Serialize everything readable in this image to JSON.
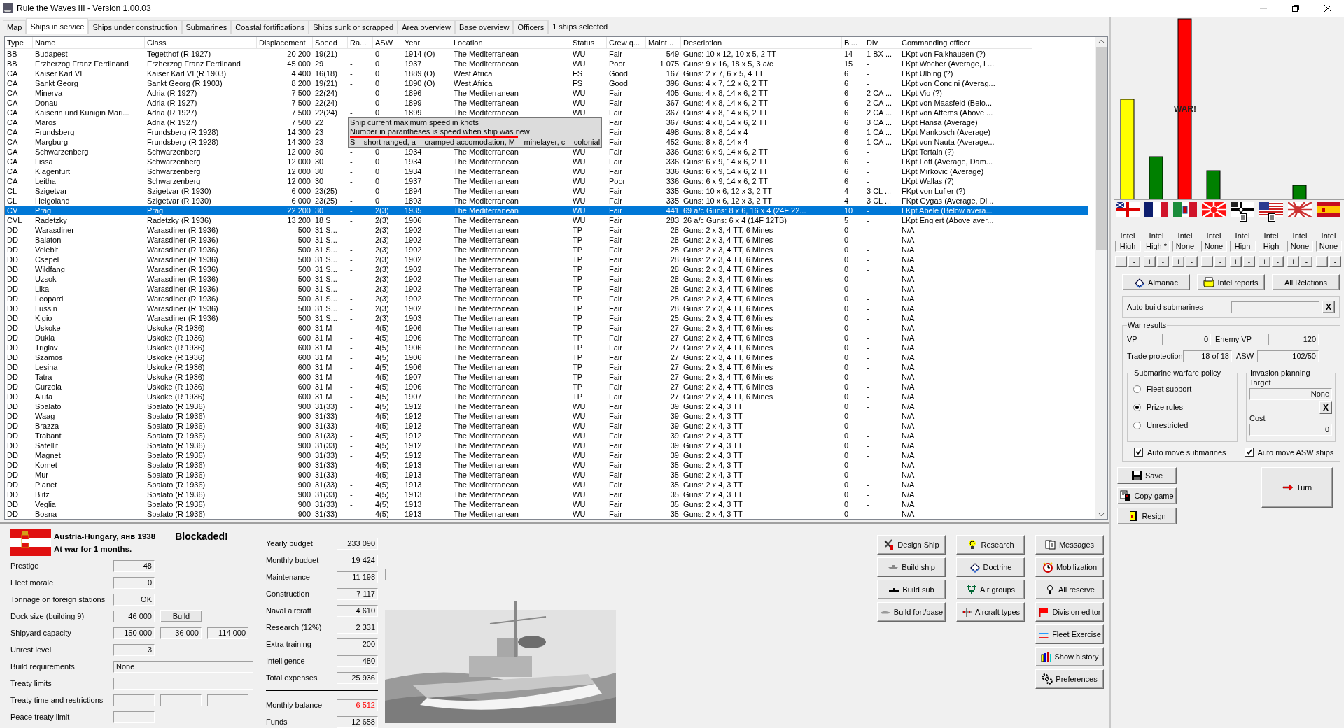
{
  "window": {
    "title": "Rule the Waves III - Version 1.00.03"
  },
  "tabs": [
    {
      "label": "Map",
      "selected": false
    },
    {
      "label": "Ships in service",
      "selected": true
    },
    {
      "label": "Ships under construction",
      "selected": false
    },
    {
      "label": "Submarines",
      "selected": false
    },
    {
      "label": "Coastal fortifications",
      "selected": false
    },
    {
      "label": "Ships sunk or scrapped",
      "selected": false
    },
    {
      "label": "Area overview",
      "selected": false
    },
    {
      "label": "Base overview",
      "selected": false
    },
    {
      "label": "Officers",
      "selected": false
    }
  ],
  "selection_count": "1 ships selected",
  "table": {
    "columns": [
      "Type",
      "Name",
      "Class",
      "Displacement",
      "Speed",
      "Ra...",
      "ASW",
      "Year",
      "Location",
      "Status",
      "Crew q...",
      "Maint...",
      "Description",
      "Bl...",
      "Div",
      "Commanding officer"
    ],
    "rows": [
      {
        "cells": [
          "BB",
          "Budapest",
          "Tegetthof (R 1927)",
          "20 200",
          "19(21)",
          "-",
          "0",
          "1914 (O)",
          "The Mediterranean",
          "WU",
          "Fair",
          "549",
          "Guns: 10 x 12, 10 x 5, 2 TT",
          "14",
          "1 BX ...",
          "LKpt von Falkhausen (?)"
        ],
        "selected": false
      },
      {
        "cells": [
          "BB",
          "Erzherzog Franz Ferdinand",
          "Erzherzog Franz Ferdinand",
          "45 000",
          "29",
          "-",
          "0",
          "1937",
          "The Mediterranean",
          "WU",
          "Poor",
          "1 075",
          "Guns: 9 x 16, 18 x 5, 3 a/c",
          "15",
          "-",
          "LKpt Wocher (Average, L..."
        ],
        "selected": false
      },
      {
        "cells": [
          "CA",
          "Kaiser Karl VI",
          "Kaiser Karl VI (R 1903)",
          "4 400",
          "16(18)",
          "-",
          "0",
          "1889 (O)",
          "West Africa",
          "FS",
          "Good",
          "167",
          "Guns: 2 x 7, 6 x 5, 4 TT",
          "6",
          "-",
          "LKpt Ulbing (?)"
        ],
        "selected": false
      },
      {
        "cells": [
          "CA",
          "Sankt Georg",
          "Sankt Georg (R 1903)",
          "8 200",
          "19(21)",
          "-",
          "0",
          "1890 (O)",
          "West Africa",
          "FS",
          "Good",
          "396",
          "Guns: 4 x 7, 12 x 6, 2 TT",
          "6",
          "-",
          "LKpt von Concini (Averag..."
        ],
        "selected": false
      },
      {
        "cells": [
          "CA",
          "Minerva",
          "Adria (R 1927)",
          "7 500",
          "22(24)",
          "-",
          "0",
          "1896",
          "The Mediterranean",
          "WU",
          "Fair",
          "405",
          "Guns: 4 x 8, 14 x 6, 2 TT",
          "6",
          "2 CA ...",
          "LKpt Vio (?)"
        ],
        "selected": false
      },
      {
        "cells": [
          "CA",
          "Donau",
          "Adria (R 1927)",
          "7 500",
          "22(24)",
          "-",
          "0",
          "1899",
          "The Mediterranean",
          "WU",
          "Fair",
          "367",
          "Guns: 4 x 8, 14 x 6, 2 TT",
          "6",
          "2 CA ...",
          "LKpt von Maasfeld (Belo..."
        ],
        "selected": false
      },
      {
        "cells": [
          "CA",
          "Kaiserin und Kunigin Mari...",
          "Adria (R 1927)",
          "7 500",
          "22(24)",
          "-",
          "0",
          "1899",
          "The Mediterranean",
          "WU",
          "Fair",
          "367",
          "Guns: 4 x 8, 14 x 6, 2 TT",
          "6",
          "2 CA ...",
          "LKpt von Attems (Above ..."
        ],
        "selected": false
      },
      {
        "cells": [
          "CA",
          "Maros",
          "Adria (R 1927)",
          "7 500",
          "22",
          null,
          null,
          null,
          null,
          null,
          "Fair",
          "367",
          "Guns: 4 x 8, 14 x 6, 2 TT",
          "6",
          "3 CA ...",
          "LKpt Hansa (Average)"
        ],
        "selected": false
      },
      {
        "cells": [
          "CA",
          "Frundsberg",
          "Frundsberg (R 1928)",
          "14 300",
          "23",
          null,
          null,
          null,
          null,
          null,
          "Fair",
          "498",
          "Guns: 8 x 8, 14 x 4",
          "6",
          "1 CA ...",
          "LKpt Mankosch (Average)"
        ],
        "selected": false
      },
      {
        "cells": [
          "CA",
          "Margburg",
          "Frundsberg (R 1928)",
          "14 300",
          "23",
          null,
          null,
          null,
          null,
          null,
          "Fair",
          "452",
          "Guns: 8 x 8, 14 x 4",
          "6",
          "1 CA ...",
          "LKpt von Nauta (Average..."
        ],
        "selected": false
      },
      {
        "cells": [
          "CA",
          "Schwarzenberg",
          "Schwarzenberg",
          "12 000",
          "30",
          "-",
          "0",
          "1934",
          "The Mediterranean",
          "WU",
          "Fair",
          "336",
          "Guns: 6 x 9, 14 x 6, 2 TT",
          "6",
          "-",
          "LKpt Tertain (?)"
        ],
        "selected": false
      },
      {
        "cells": [
          "CA",
          "Lissa",
          "Schwarzenberg",
          "12 000",
          "30",
          "-",
          "0",
          "1934",
          "The Mediterranean",
          "WU",
          "Fair",
          "336",
          "Guns: 6 x 9, 14 x 6, 2 TT",
          "6",
          "-",
          "LKpt Lott (Average, Dam..."
        ],
        "selected": false
      },
      {
        "cells": [
          "CA",
          "Klagenfurt",
          "Schwarzenberg",
          "12 000",
          "30",
          "-",
          "0",
          "1934",
          "The Mediterranean",
          "WU",
          "Fair",
          "336",
          "Guns: 6 x 9, 14 x 6, 2 TT",
          "6",
          "-",
          "LKpt Mirkovic (Average)"
        ],
        "selected": false
      },
      {
        "cells": [
          "CA",
          "Leitha",
          "Schwarzenberg",
          "12 000",
          "30",
          "-",
          "0",
          "1937",
          "The Mediterranean",
          "WU",
          "Poor",
          "336",
          "Guns: 6 x 9, 14 x 6, 2 TT",
          "6",
          "-",
          "LKpt Wallas (?)"
        ],
        "selected": false
      },
      {
        "cells": [
          "CL",
          "Szigetvar",
          "Szigetvar (R 1930)",
          "6 000",
          "23(25)",
          "-",
          "0",
          "1894",
          "The Mediterranean",
          "WU",
          "Fair",
          "335",
          "Guns: 10 x 6, 12 x 3, 2 TT",
          "4",
          "3 CL ...",
          "FKpt von Lufler (?)"
        ],
        "selected": false
      },
      {
        "cells": [
          "CL",
          "Helgoland",
          "Szigetvar (R 1930)",
          "6 000",
          "23(25)",
          "-",
          "0",
          "1893",
          "The Mediterranean",
          "WU",
          "Fair",
          "335",
          "Guns: 10 x 6, 12 x 3, 2 TT",
          "4",
          "3 CL ...",
          "FKpt Gygas (Average, Di..."
        ],
        "selected": false
      },
      {
        "cells": [
          "CV",
          "Prag",
          "Prag",
          "22 200",
          "30",
          "-",
          "2(3)",
          "1935",
          "The Mediterranean",
          "WU",
          "Fair",
          "441",
          "69 a/c Guns: 8 x 6, 16 x 4 (24F 22...",
          "10",
          "-",
          "LKpt Abele (Below avera..."
        ],
        "selected": true
      },
      {
        "cells": [
          "CVL",
          "Radetzky",
          "Radetzky (R 1936)",
          "13 200",
          "18 S",
          "-",
          "2(3)",
          "1906",
          "The Mediterranean",
          "WU",
          "Fair",
          "283",
          "26 a/c Guns: 6 x 4 (14F 12TB)",
          "5",
          "-",
          "LKpt Englert (Above aver..."
        ],
        "selected": false
      },
      {
        "cells": [
          "DD",
          "Warasdiner",
          "Warasdiner (R 1936)",
          "500",
          "31 S...",
          "-",
          "2(3)",
          "1902",
          "The Mediterranean",
          "TP",
          "Fair",
          "28",
          "Guns: 2 x 3, 4 TT, 6 Mines",
          "0",
          "-",
          "N/A"
        ],
        "selected": false
      },
      {
        "cells": [
          "DD",
          "Balaton",
          "Warasdiner (R 1936)",
          "500",
          "31 S...",
          "-",
          "2(3)",
          "1902",
          "The Mediterranean",
          "TP",
          "Fair",
          "28",
          "Guns: 2 x 3, 4 TT, 6 Mines",
          "0",
          "-",
          "N/A"
        ],
        "selected": false
      },
      {
        "cells": [
          "DD",
          "Velebit",
          "Warasdiner (R 1936)",
          "500",
          "31 S...",
          "-",
          "2(3)",
          "1902",
          "The Mediterranean",
          "TP",
          "Fair",
          "28",
          "Guns: 2 x 3, 4 TT, 6 Mines",
          "0",
          "-",
          "N/A"
        ],
        "selected": false
      },
      {
        "cells": [
          "DD",
          "Csepel",
          "Warasdiner (R 1936)",
          "500",
          "31 S...",
          "-",
          "2(3)",
          "1902",
          "The Mediterranean",
          "TP",
          "Fair",
          "28",
          "Guns: 2 x 3, 4 TT, 6 Mines",
          "0",
          "-",
          "N/A"
        ],
        "selected": false
      },
      {
        "cells": [
          "DD",
          "Wildfang",
          "Warasdiner (R 1936)",
          "500",
          "31 S...",
          "-",
          "2(3)",
          "1902",
          "The Mediterranean",
          "TP",
          "Fair",
          "28",
          "Guns: 2 x 3, 4 TT, 6 Mines",
          "0",
          "-",
          "N/A"
        ],
        "selected": false
      },
      {
        "cells": [
          "DD",
          "Uzsok",
          "Warasdiner (R 1936)",
          "500",
          "31 S...",
          "-",
          "2(3)",
          "1902",
          "The Mediterranean",
          "TP",
          "Fair",
          "28",
          "Guns: 2 x 3, 4 TT, 6 Mines",
          "0",
          "-",
          "N/A"
        ],
        "selected": false
      },
      {
        "cells": [
          "DD",
          "Lika",
          "Warasdiner (R 1936)",
          "500",
          "31 S...",
          "-",
          "2(3)",
          "1902",
          "The Mediterranean",
          "TP",
          "Fair",
          "28",
          "Guns: 2 x 3, 4 TT, 6 Mines",
          "0",
          "-",
          "N/A"
        ],
        "selected": false
      },
      {
        "cells": [
          "DD",
          "Leopard",
          "Warasdiner (R 1936)",
          "500",
          "31 S...",
          "-",
          "2(3)",
          "1902",
          "The Mediterranean",
          "TP",
          "Fair",
          "28",
          "Guns: 2 x 3, 4 TT, 6 Mines",
          "0",
          "-",
          "N/A"
        ],
        "selected": false
      },
      {
        "cells": [
          "DD",
          "Lussin",
          "Warasdiner (R 1936)",
          "500",
          "31 S...",
          "-",
          "2(3)",
          "1902",
          "The Mediterranean",
          "TP",
          "Fair",
          "28",
          "Guns: 2 x 3, 4 TT, 6 Mines",
          "0",
          "-",
          "N/A"
        ],
        "selected": false
      },
      {
        "cells": [
          "DD",
          "Kigio",
          "Warasdiner (R 1936)",
          "500",
          "31 S...",
          "-",
          "2(3)",
          "1903",
          "The Mediterranean",
          "TP",
          "Fair",
          "25",
          "Guns: 2 x 3, 4 TT, 6 Mines",
          "0",
          "-",
          "N/A"
        ],
        "selected": false
      },
      {
        "cells": [
          "DD",
          "Uskoke",
          "Uskoke (R 1936)",
          "600",
          "31 M",
          "-",
          "4(5)",
          "1906",
          "The Mediterranean",
          "TP",
          "Fair",
          "27",
          "Guns: 2 x 3, 4 TT, 6 Mines",
          "0",
          "-",
          "N/A"
        ],
        "selected": false
      },
      {
        "cells": [
          "DD",
          "Dukla",
          "Uskoke (R 1936)",
          "600",
          "31 M",
          "-",
          "4(5)",
          "1906",
          "The Mediterranean",
          "TP",
          "Fair",
          "27",
          "Guns: 2 x 3, 4 TT, 6 Mines",
          "0",
          "-",
          "N/A"
        ],
        "selected": false
      },
      {
        "cells": [
          "DD",
          "Triglav",
          "Uskoke (R 1936)",
          "600",
          "31 M",
          "-",
          "4(5)",
          "1906",
          "The Mediterranean",
          "TP",
          "Fair",
          "27",
          "Guns: 2 x 3, 4 TT, 6 Mines",
          "0",
          "-",
          "N/A"
        ],
        "selected": false
      },
      {
        "cells": [
          "DD",
          "Szamos",
          "Uskoke (R 1936)",
          "600",
          "31 M",
          "-",
          "4(5)",
          "1906",
          "The Mediterranean",
          "TP",
          "Fair",
          "27",
          "Guns: 2 x 3, 4 TT, 6 Mines",
          "0",
          "-",
          "N/A"
        ],
        "selected": false
      },
      {
        "cells": [
          "DD",
          "Lesina",
          "Uskoke (R 1936)",
          "600",
          "31 M",
          "-",
          "4(5)",
          "1906",
          "The Mediterranean",
          "TP",
          "Fair",
          "27",
          "Guns: 2 x 3, 4 TT, 6 Mines",
          "0",
          "-",
          "N/A"
        ],
        "selected": false
      },
      {
        "cells": [
          "DD",
          "Tatra",
          "Uskoke (R 1936)",
          "600",
          "31 M",
          "-",
          "4(5)",
          "1907",
          "The Mediterranean",
          "TP",
          "Fair",
          "27",
          "Guns: 2 x 3, 4 TT, 6 Mines",
          "0",
          "-",
          "N/A"
        ],
        "selected": false
      },
      {
        "cells": [
          "DD",
          "Curzola",
          "Uskoke (R 1936)",
          "600",
          "31 M",
          "-",
          "4(5)",
          "1906",
          "The Mediterranean",
          "TP",
          "Fair",
          "27",
          "Guns: 2 x 3, 4 TT, 6 Mines",
          "0",
          "-",
          "N/A"
        ],
        "selected": false
      },
      {
        "cells": [
          "DD",
          "Aluta",
          "Uskoke (R 1936)",
          "600",
          "31 M",
          "-",
          "4(5)",
          "1907",
          "The Mediterranean",
          "TP",
          "Fair",
          "27",
          "Guns: 2 x 3, 4 TT, 6 Mines",
          "0",
          "-",
          "N/A"
        ],
        "selected": false
      },
      {
        "cells": [
          "DD",
          "Spalato",
          "Spalato (R 1936)",
          "900",
          "31(33)",
          "-",
          "4(5)",
          "1912",
          "The Mediterranean",
          "WU",
          "Fair",
          "39",
          "Guns: 2 x 4, 3 TT",
          "0",
          "-",
          "N/A"
        ],
        "selected": false
      },
      {
        "cells": [
          "DD",
          "Waag",
          "Spalato (R 1936)",
          "900",
          "31(33)",
          "-",
          "4(5)",
          "1912",
          "The Mediterranean",
          "WU",
          "Fair",
          "39",
          "Guns: 2 x 4, 3 TT",
          "0",
          "-",
          "N/A"
        ],
        "selected": false
      },
      {
        "cells": [
          "DD",
          "Brazza",
          "Spalato (R 1936)",
          "900",
          "31(33)",
          "-",
          "4(5)",
          "1912",
          "The Mediterranean",
          "WU",
          "Fair",
          "39",
          "Guns: 2 x 4, 3 TT",
          "0",
          "-",
          "N/A"
        ],
        "selected": false
      },
      {
        "cells": [
          "DD",
          "Trabant",
          "Spalato (R 1936)",
          "900",
          "31(33)",
          "-",
          "4(5)",
          "1912",
          "The Mediterranean",
          "WU",
          "Fair",
          "39",
          "Guns: 2 x 4, 3 TT",
          "0",
          "-",
          "N/A"
        ],
        "selected": false
      },
      {
        "cells": [
          "DD",
          "Satellit",
          "Spalato (R 1936)",
          "900",
          "31(33)",
          "-",
          "4(5)",
          "1912",
          "The Mediterranean",
          "WU",
          "Fair",
          "39",
          "Guns: 2 x 4, 3 TT",
          "0",
          "-",
          "N/A"
        ],
        "selected": false
      },
      {
        "cells": [
          "DD",
          "Magnet",
          "Spalato (R 1936)",
          "900",
          "31(33)",
          "-",
          "4(5)",
          "1912",
          "The Mediterranean",
          "WU",
          "Fair",
          "39",
          "Guns: 2 x 4, 3 TT",
          "0",
          "-",
          "N/A"
        ],
        "selected": false
      },
      {
        "cells": [
          "DD",
          "Komet",
          "Spalato (R 1936)",
          "900",
          "31(33)",
          "-",
          "4(5)",
          "1913",
          "The Mediterranean",
          "WU",
          "Fair",
          "35",
          "Guns: 2 x 4, 3 TT",
          "0",
          "-",
          "N/A"
        ],
        "selected": false
      },
      {
        "cells": [
          "DD",
          "Mur",
          "Spalato (R 1936)",
          "900",
          "31(33)",
          "-",
          "4(5)",
          "1913",
          "The Mediterranean",
          "WU",
          "Fair",
          "35",
          "Guns: 2 x 4, 3 TT",
          "0",
          "-",
          "N/A"
        ],
        "selected": false
      },
      {
        "cells": [
          "DD",
          "Planet",
          "Spalato (R 1936)",
          "900",
          "31(33)",
          "-",
          "4(5)",
          "1913",
          "The Mediterranean",
          "WU",
          "Fair",
          "35",
          "Guns: 2 x 4, 3 TT",
          "0",
          "-",
          "N/A"
        ],
        "selected": false
      },
      {
        "cells": [
          "DD",
          "Blitz",
          "Spalato (R 1936)",
          "900",
          "31(33)",
          "-",
          "4(5)",
          "1913",
          "The Mediterranean",
          "WU",
          "Fair",
          "35",
          "Guns: 2 x 4, 3 TT",
          "0",
          "-",
          "N/A"
        ],
        "selected": false
      },
      {
        "cells": [
          "DD",
          "Veglia",
          "Spalato (R 1936)",
          "900",
          "31(33)",
          "-",
          "4(5)",
          "1913",
          "The Mediterranean",
          "WU",
          "Fair",
          "35",
          "Guns: 2 x 4, 3 TT",
          "0",
          "-",
          "N/A"
        ],
        "selected": false
      },
      {
        "cells": [
          "DD",
          "Bosna",
          "Spalato (R 1936)",
          "900",
          "31(33)",
          "-",
          "4(5)",
          "1913",
          "The Mediterranean",
          "WU",
          "Fair",
          "35",
          "Guns: 2 x 4, 3 TT",
          "0",
          "-",
          "N/A"
        ],
        "selected": false
      }
    ]
  },
  "tooltip": {
    "lines": [
      "Ship current maximum speed in knots",
      "Number in parantheses is speed when ship was new",
      "S = short ranged, a = cramped accomodation, M = minelayer, c = colonial"
    ]
  },
  "relations": {
    "war_label": "WAR!",
    "nations": [
      {
        "intel_label": "Intel",
        "intel": "High",
        "plus": "+",
        "minus": "-",
        "report": false
      },
      {
        "intel_label": "Intel",
        "intel": "High *",
        "plus": "+",
        "minus": "-",
        "report": false
      },
      {
        "intel_label": "Intel",
        "intel": "None",
        "plus": "+",
        "minus": "-",
        "report": false
      },
      {
        "intel_label": "Intel",
        "intel": "None",
        "plus": "+",
        "minus": "-",
        "report": false
      },
      {
        "intel_label": "Intel",
        "intel": "High",
        "plus": "+",
        "minus": "-",
        "report": true
      },
      {
        "intel_label": "Intel",
        "intel": "High",
        "plus": "+",
        "minus": "-",
        "report": true
      },
      {
        "intel_label": "Intel",
        "intel": "None",
        "plus": "+",
        "minus": "-",
        "report": false
      },
      {
        "intel_label": "Intel",
        "intel": "None",
        "plus": "+",
        "minus": "-",
        "report": false
      }
    ],
    "buttons": [
      "Almanac",
      "Intel reports",
      "All Relations"
    ]
  },
  "auto_build": {
    "label": "Auto build submarines",
    "clear": "X"
  },
  "war_results": {
    "title": "War results",
    "vp_label": "VP",
    "vp": "0",
    "enemy_vp_label": "Enemy VP",
    "enemy_vp": "120",
    "trade_label": "Trade protection",
    "trade": "18 of 18",
    "asw_label": "ASW",
    "asw": "102/50",
    "policy": {
      "title": "Submarine warfare policy",
      "options": [
        {
          "label": "Fleet support",
          "selected": false
        },
        {
          "label": "Prize rules",
          "selected": true
        },
        {
          "label": "Unrestricted",
          "selected": false
        }
      ]
    },
    "invasion": {
      "title": "Invasion planning",
      "target_label": "Target",
      "target": "None",
      "clear": "X",
      "cost_label": "Cost",
      "cost": "0"
    },
    "checkboxes": [
      {
        "label": "Auto move submarines",
        "checked": true
      },
      {
        "label": "Auto move ASW ships",
        "checked": true
      }
    ]
  },
  "game_buttons": [
    "Save",
    "Copy game",
    "Resign"
  ],
  "turn_button": "Turn",
  "nation": {
    "name": "Austria-Hungary, янв 1938",
    "war_status": "At war for 1 months.",
    "alert": "Blockaded!"
  },
  "stats": [
    {
      "label": "Prestige",
      "kind": "single",
      "values": [
        "48"
      ]
    },
    {
      "label": "Fleet morale",
      "kind": "single",
      "values": [
        "0"
      ]
    },
    {
      "label": "Tonnage on foreign stations",
      "kind": "single",
      "values": [
        "OK"
      ]
    },
    {
      "label": "Dock size (building 9)",
      "kind": "button",
      "values": [
        "46 000"
      ],
      "button": "Build"
    },
    {
      "label": "Shipyard capacity",
      "kind": "triple",
      "values": [
        "150 000",
        "36 000",
        "114 000"
      ]
    },
    {
      "label": "Unrest level",
      "kind": "single",
      "values": [
        "3"
      ]
    },
    {
      "label": "Build requirements",
      "kind": "wide",
      "values": [
        "None"
      ]
    },
    {
      "label": "Treaty limits",
      "kind": "wide"
    },
    {
      "label": "Treaty time and restrictions",
      "kind": "triple",
      "values": [
        "-"
      ]
    },
    {
      "label": "Peace treaty limit",
      "kind": "single"
    }
  ],
  "expenses": [
    {
      "label": "Yearly budget",
      "value": "233 090"
    },
    {
      "label": "Monthly budget",
      "value": "19 424"
    },
    {
      "label": "Maintenance",
      "value": "11 198"
    },
    {
      "label": "Construction",
      "value": "7 117"
    },
    {
      "label": "Naval aircraft",
      "value": "4 610"
    },
    {
      "label": "Research (12%)",
      "value": "2 331"
    },
    {
      "label": "Extra training",
      "value": "200"
    },
    {
      "label": "Intelligence",
      "value": "480"
    },
    {
      "label": "Total expenses",
      "value": "25 936"
    }
  ],
  "balance": [
    {
      "label": "Monthly balance",
      "value": "-6 512",
      "negative": true
    },
    {
      "label": "Funds",
      "value": "12 658",
      "negative": false
    }
  ],
  "actions": [
    [
      "Design Ship",
      "Build ship",
      "Build sub",
      "Build fort/base"
    ],
    [
      "Research",
      "Doctrine",
      "Air groups",
      "Aircraft types"
    ],
    [
      "Messages",
      "Mobilization",
      "All reserve",
      "Division editor",
      "Fleet Exercise",
      "Show history",
      "Preferences"
    ]
  ]
}
